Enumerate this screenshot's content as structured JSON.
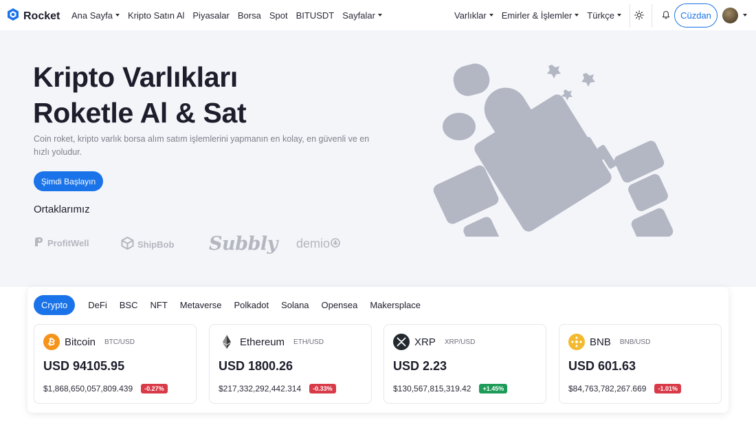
{
  "brand": {
    "name": "Rocket"
  },
  "nav_left": [
    {
      "label": "Ana Sayfa",
      "dropdown": true
    },
    {
      "label": "Kripto Satın Al",
      "dropdown": false
    },
    {
      "label": "Piyasalar",
      "dropdown": false
    },
    {
      "label": "Borsa",
      "dropdown": false
    },
    {
      "label": "Spot",
      "dropdown": false
    },
    {
      "label": "BITUSDT",
      "dropdown": false
    },
    {
      "label": "Sayfalar",
      "dropdown": true
    }
  ],
  "nav_right": [
    {
      "label": "Varlıklar",
      "dropdown": true
    },
    {
      "label": "Emirler & İşlemler",
      "dropdown": true
    },
    {
      "label": "Türkçe",
      "dropdown": true
    }
  ],
  "wallet_button": "Cüzdan",
  "hero": {
    "title_line1": "Kripto Varlıkları",
    "title_line2": "Roketle Al & Sat",
    "description": "Coin roket, kripto varlık borsa alım satım işlemlerini yapmanın en kolay, en güvenli ve en hızlı yoludur.",
    "cta": "Şimdi Başlayın",
    "partners_title": "Ortaklarımız"
  },
  "partners": [
    "ProfitWell",
    "ShipBob",
    "Subbly",
    "demio"
  ],
  "tabs": [
    "Crypto",
    "DeFi",
    "BSC",
    "NFT",
    "Metaverse",
    "Polkadot",
    "Solana",
    "Opensea",
    "Makersplace"
  ],
  "active_tab": "Crypto",
  "coins": [
    {
      "name": "Bitcoin",
      "pair": "BTC/USD",
      "price": "USD 94105.95",
      "market_cap": "$1,868,650,057,809.439",
      "change": "-0.27%",
      "direction": "down",
      "icon": "bitcoin-icon",
      "color": "#f7931a"
    },
    {
      "name": "Ethereum",
      "pair": "ETH/USD",
      "price": "USD 1800.26",
      "market_cap": "$217,332,292,442.314",
      "change": "-0.33%",
      "direction": "down",
      "icon": "ethereum-icon",
      "color": "#3c3c3d"
    },
    {
      "name": "XRP",
      "pair": "XRP/USD",
      "price": "USD 2.23",
      "market_cap": "$130,567,815,319.42",
      "change": "+1.45%",
      "direction": "up",
      "icon": "xrp-icon",
      "color": "#23292f"
    },
    {
      "name": "BNB",
      "pair": "BNB/USD",
      "price": "USD 601.63",
      "market_cap": "$84,763,782,267.669",
      "change": "-1.01%",
      "direction": "down",
      "icon": "bnb-icon",
      "color": "#f3ba2f"
    }
  ],
  "colors": {
    "primary": "#1a73e8",
    "hero_bg": "#f4f5f9",
    "negative": "#d93a48",
    "positive": "#1e9b58",
    "illustration": "#b3b6c3"
  }
}
